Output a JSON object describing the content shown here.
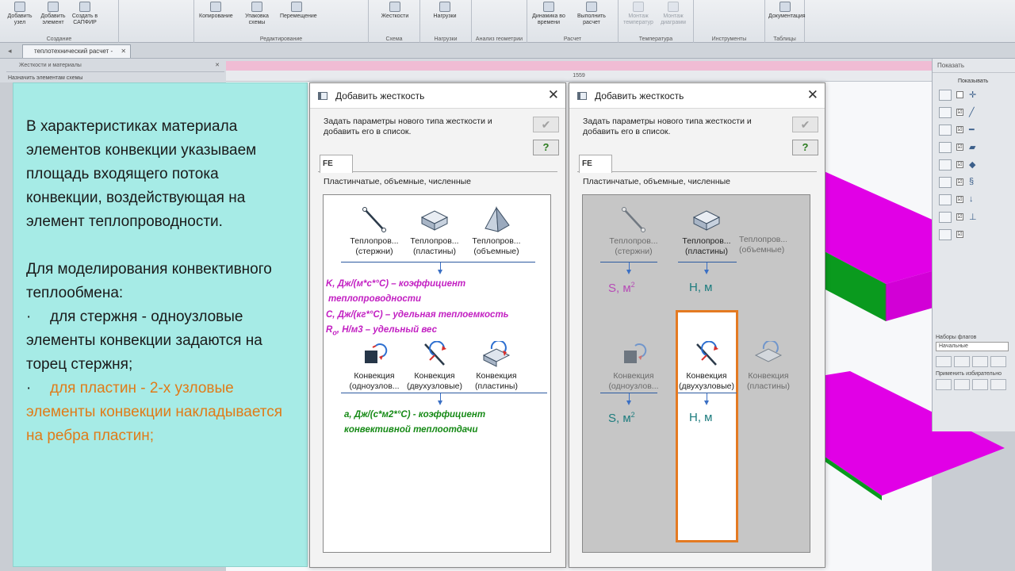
{
  "ribbon": {
    "groups": [
      {
        "name": "Создание",
        "buttons": [
          "Добавить узел",
          "Добавить элемент",
          "Создать в САПФИР"
        ]
      },
      {
        "name": "Редактирование",
        "buttons": [
          "Копирование",
          "Упаковка схемы",
          "Перемещение"
        ]
      },
      {
        "name": "Схема",
        "buttons": [
          "Жесткости"
        ]
      },
      {
        "name": "Нагрузки",
        "buttons": [
          "Нагрузки"
        ]
      },
      {
        "name": "Анализ геометрии",
        "buttons": [
          ""
        ]
      },
      {
        "name": "Расчет",
        "buttons": [
          "Динамика во времени",
          "Выполнить расчет"
        ]
      },
      {
        "name": "Температура",
        "buttons": [
          "Монтаж температур",
          "Монтаж диаграмм"
        ]
      },
      {
        "name": "Инструменты",
        "buttons": [
          ""
        ]
      },
      {
        "name": "Таблицы",
        "buttons": [
          "Документация"
        ]
      }
    ]
  },
  "doc_tab": {
    "label": "теплотехнический расчет -"
  },
  "left_panel": {
    "title": "Жесткости и материалы",
    "subtitle": "Назначить элементам схемы"
  },
  "ruler_value": "1559",
  "info": {
    "para1": "В характеристиках материала элементов конвекции указываем площадь входящего потока конвекции, воздействующая на элемент теплопроводности.",
    "para2": "Для моделирования конвективного теплообмена:",
    "bullet_marker": "·",
    "bullet1": "для стержня - одноузловые элементы конвекции задаются на торец стержня;",
    "bullet2": "для пластин - 2-х узловые элементы конвекции накладывается на ребра пластин;"
  },
  "dialog": {
    "title": "Добавить жесткость",
    "prompt": "Задать параметры нового типа жесткости и добавить его в список.",
    "ok_glyph": "✔",
    "help_glyph": "?",
    "tab_label": "FE",
    "section": "Пластинчатые, объемные, численные",
    "row1": [
      {
        "icon": "rod-icon",
        "label": "Теплопров... (стержни)"
      },
      {
        "icon": "plate-icon",
        "label": "Теплопров... (пластины)"
      },
      {
        "icon": "pyramid-icon",
        "label": "Теплопров... (объемные)"
      }
    ],
    "row2": [
      {
        "icon": "convection-single-node-icon",
        "label": "Конвекция (одноузлов..."
      },
      {
        "icon": "convection-two-node-icon",
        "label": "Конвекция (двухузловые)"
      },
      {
        "icon": "convection-plate-icon",
        "label": "Конвекция (пластины)"
      }
    ],
    "row1_partial_label": "Теплопров... (объемные)"
  },
  "annotations": {
    "k": "K, Дж/(м*с*°С) – коэффициент",
    "k2": "теплопроводности",
    "c": "С, Дж/(кг*°С) – удельная теплоемкость",
    "r_main": "R",
    "r_sub": "о",
    "r_rest": ", Н/м3 – удельный вес",
    "alpha": "а, Дж/(с*м2*°С) - коэффициент",
    "alpha2": "конвективной теплоотдачи",
    "s_main": "S, м",
    "s_sup": "2",
    "h": "H, м"
  },
  "right_panel": {
    "header": "Показать",
    "show_label": "Показывать",
    "flags_label": "Наборы флагов",
    "flags_value": "Начальные",
    "apply_label": "Применить избирательно",
    "check_glyph": "☑"
  },
  "colors": {
    "teal_panel": "#a6ebe6",
    "magenta_annotation": "#c21fc2",
    "green_annotation": "#168a16",
    "highlight": "#e47a22",
    "plate_top": "#e100e6",
    "plate_edge": "#0a9a1e"
  }
}
